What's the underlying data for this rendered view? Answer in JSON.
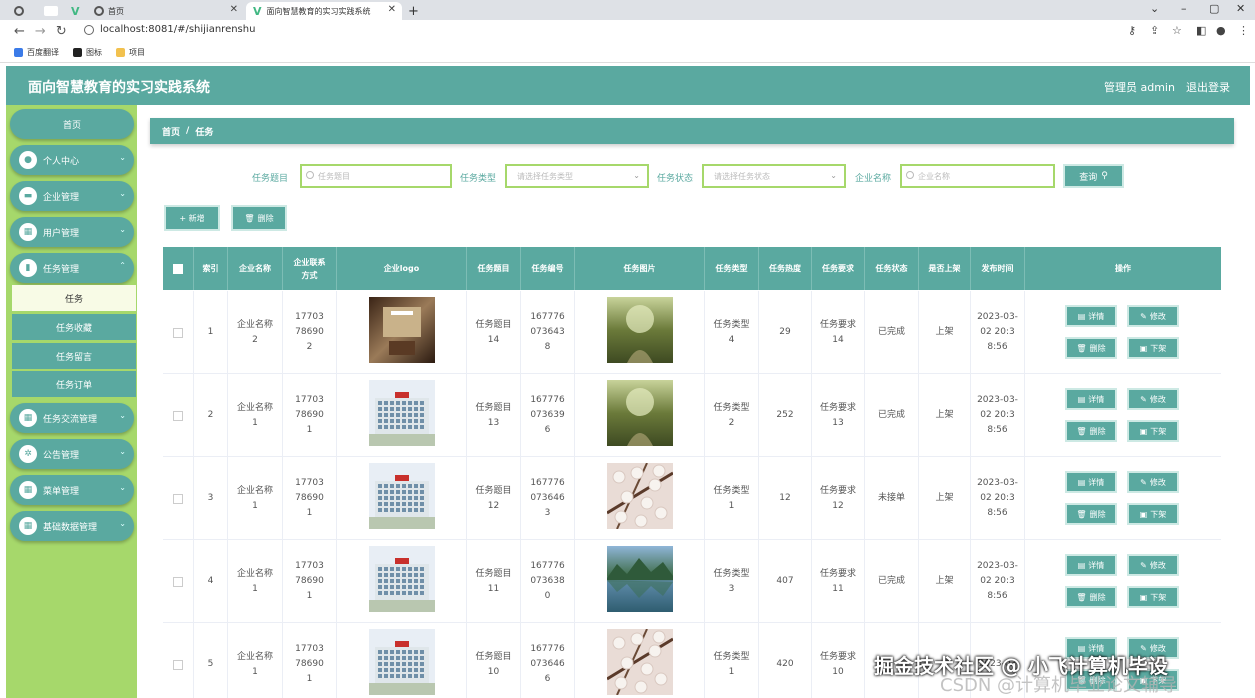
{
  "browser": {
    "tabs": [
      {
        "label": ""
      },
      {
        "label": "首页"
      },
      {
        "label": "面向智慧教育的实习实践系统"
      }
    ],
    "url": "localhost:8081/#/shijianrenshu",
    "bookmarks": [
      "百度翻译",
      "图标",
      "项目"
    ],
    "bookmark_colors": [
      "#3b7be8",
      "#222222",
      "#f2c14e"
    ]
  },
  "app": {
    "title": "面向智慧教育的实习实践系统",
    "user": "管理员 admin",
    "logout": "退出登录"
  },
  "sidebar": {
    "home": "首页",
    "menus": [
      {
        "label": "个人中心",
        "icon": "person-icon"
      },
      {
        "label": "企业管理",
        "icon": "monitor-icon"
      },
      {
        "label": "用户管理",
        "icon": "grid-icon"
      },
      {
        "label": "任务管理",
        "icon": "chart-icon"
      }
    ],
    "submenus": [
      "任务",
      "任务收藏",
      "任务留言",
      "任务订单"
    ],
    "menus2": [
      {
        "label": "任务交流管理",
        "icon": "grid-icon"
      },
      {
        "label": "公告管理",
        "icon": "gear-icon"
      },
      {
        "label": "菜单管理",
        "icon": "grid-icon"
      },
      {
        "label": "基础数据管理",
        "icon": "grid-icon"
      }
    ]
  },
  "breadcrumb": {
    "home": "首页",
    "sep": "/",
    "current": "任务"
  },
  "filters": {
    "title_label": "任务题目",
    "title_placeholder": "任务题目",
    "type_label": "任务类型",
    "type_placeholder": "请选择任务类型",
    "status_label": "任务状态",
    "status_placeholder": "请选择任务状态",
    "company_label": "企业名称",
    "company_placeholder": "企业名称",
    "search": "查询"
  },
  "actions": {
    "add": "+ 新增",
    "delete": "删除"
  },
  "table": {
    "headers": [
      "索引",
      "企业名称",
      "企业联系方式",
      "企业logo",
      "任务题目",
      "任务编号",
      "任务图片",
      "任务类型",
      "任务热度",
      "任务要求",
      "任务状态",
      "是否上架",
      "发布时间",
      "操作"
    ],
    "ops": {
      "detail": "详情",
      "edit": "修改",
      "delete": "删除",
      "offline": "下架"
    },
    "rows": [
      {
        "index": "1",
        "company": "企业名称2",
        "phone": "17703786902",
        "logo": "lobby",
        "title": "任务题目14",
        "code": "1677760736438",
        "pic": "forest",
        "type": "任务类型4",
        "heat": "29",
        "req": "任务要求14",
        "status": "已完成",
        "onsale": "上架",
        "time": "2023-03-02 20:38:56"
      },
      {
        "index": "2",
        "company": "企业名称1",
        "phone": "17703786901",
        "logo": "building",
        "title": "任务题目13",
        "code": "1677760736396",
        "pic": "forest",
        "type": "任务类型2",
        "heat": "252",
        "req": "任务要求13",
        "status": "已完成",
        "onsale": "上架",
        "time": "2023-03-02 20:38:56"
      },
      {
        "index": "3",
        "company": "企业名称1",
        "phone": "17703786901",
        "logo": "building",
        "title": "任务题目12",
        "code": "1677760736463",
        "pic": "blossom",
        "type": "任务类型1",
        "heat": "12",
        "req": "任务要求12",
        "status": "未接单",
        "onsale": "上架",
        "time": "2023-03-02 20:38:56"
      },
      {
        "index": "4",
        "company": "企业名称1",
        "phone": "17703786901",
        "logo": "building",
        "title": "任务题目11",
        "code": "1677760736380",
        "pic": "lake",
        "type": "任务类型3",
        "heat": "407",
        "req": "任务要求11",
        "status": "已完成",
        "onsale": "上架",
        "time": "2023-03-02 20:38:56"
      },
      {
        "index": "5",
        "company": "企业名称1",
        "phone": "17703786901",
        "logo": "building",
        "title": "任务题目10",
        "code": "1677760736466",
        "pic": "blossom",
        "type": "任务类型1",
        "heat": "420",
        "req": "任务要求10",
        "status": "",
        "onsale": "",
        "time": "2023-03"
      }
    ]
  },
  "watermark": {
    "line1": "掘金技术社区 @ 小飞计算机毕设",
    "line2": "CSDN @计算机毕业论文辅导"
  },
  "colors": {
    "primary": "#5aa9a0",
    "sidebar": "#a6d86b"
  }
}
